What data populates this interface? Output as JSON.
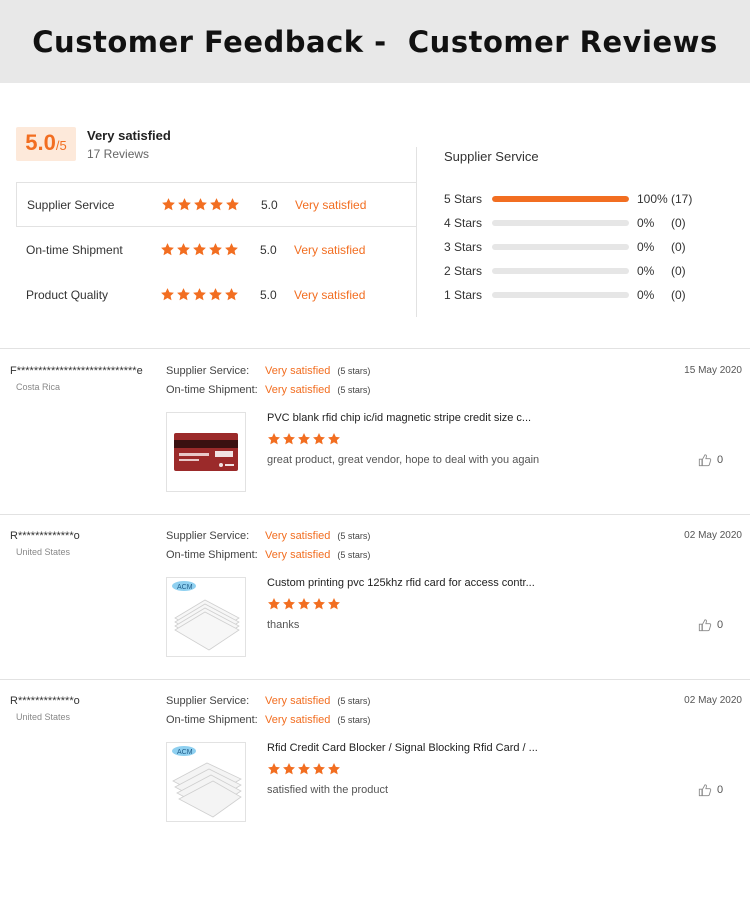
{
  "banner": {
    "title": "Customer Feedback -  Customer Reviews"
  },
  "summary": {
    "score": "5.0",
    "score_max": "/5",
    "overall_label": "Very satisfied",
    "review_count": "17 Reviews",
    "ratings": [
      {
        "name": "Supplier Service",
        "stars": 5,
        "value": "5.0",
        "text": "Very satisfied"
      },
      {
        "name": "On-time Shipment",
        "stars": 5,
        "value": "5.0",
        "text": "Very satisfied"
      },
      {
        "name": "Product Quality",
        "stars": 5,
        "value": "5.0",
        "text": "Very satisfied"
      }
    ],
    "distribution_title": "Supplier Service",
    "distribution": [
      {
        "label": "5  Stars",
        "percent": 100,
        "pct_text": "100%",
        "count": "(17)"
      },
      {
        "label": "4  Stars",
        "percent": 0,
        "pct_text": "0%",
        "count": "(0)"
      },
      {
        "label": "3  Stars",
        "percent": 0,
        "pct_text": "0%",
        "count": "(0)"
      },
      {
        "label": "2  Stars",
        "percent": 0,
        "pct_text": "0%",
        "count": "(0)"
      },
      {
        "label": "1  Stars",
        "percent": 0,
        "pct_text": "0%",
        "count": "(0)"
      }
    ]
  },
  "reviews": [
    {
      "name": "F****************************e",
      "country": "Costa Rica",
      "date": "15 May 2020",
      "service_label": "Supplier Service:",
      "service_value": "Very satisfied",
      "service_stars": "(5 stars)",
      "shipment_label": "On-time Shipment:",
      "shipment_value": "Very satisfied",
      "shipment_stars": "(5 stars)",
      "product": "PVC blank rfid chip ic/id magnetic stripe credit size c...",
      "rating": 5,
      "comment": "great product, great vendor, hope to deal with you again",
      "likes": "0"
    },
    {
      "name": "R*************o",
      "country": "United States",
      "date": "02 May 2020",
      "service_label": "Supplier Service:",
      "service_value": "Very satisfied",
      "service_stars": "(5 stars)",
      "shipment_label": "On-time Shipment:",
      "shipment_value": "Very satisfied",
      "shipment_stars": "(5 stars)",
      "product": "Custom printing pvc 125khz rfid card for access contr...",
      "rating": 5,
      "comment": "thanks",
      "likes": "0",
      "logo": "ACM"
    },
    {
      "name": "R*************o",
      "country": "United States",
      "date": "02 May 2020",
      "service_label": "Supplier Service:",
      "service_value": "Very satisfied",
      "service_stars": "(5 stars)",
      "shipment_label": "On-time Shipment:",
      "shipment_value": "Very satisfied",
      "shipment_stars": "(5 stars)",
      "product": "Rfid Credit Card Blocker / Signal Blocking Rfid Card / ...",
      "rating": 5,
      "comment": "satisfied with the product",
      "likes": "0",
      "logo": "ACM"
    }
  ],
  "colors": {
    "accent": "#f26e21",
    "banner_bg": "#e8e8e8",
    "divider": "#e2e2e2"
  },
  "icons": {
    "star": "star-icon",
    "like": "thumbs-up-icon"
  }
}
